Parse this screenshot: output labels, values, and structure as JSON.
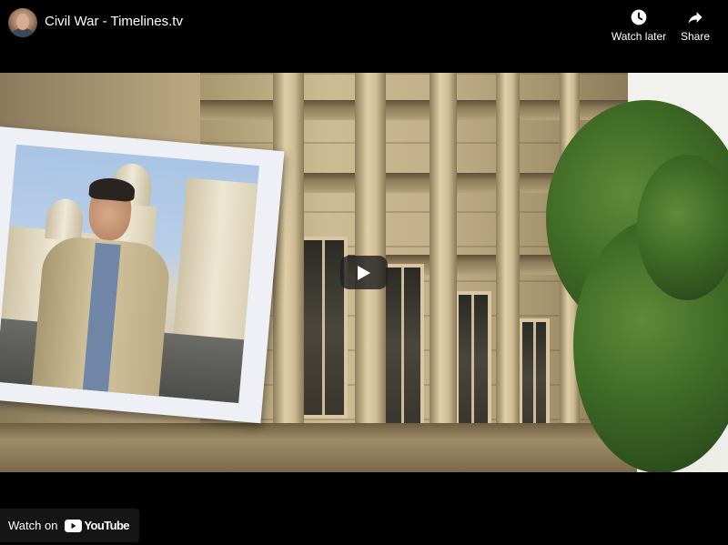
{
  "header": {
    "channel_avatar_icon": "channel-avatar",
    "title": "Civil War - Timelines.tv",
    "actions": [
      {
        "label": "Watch later",
        "icon": "clock-icon"
      },
      {
        "label": "Share",
        "icon": "share-arrow-icon"
      }
    ]
  },
  "player": {
    "play_icon": "play-icon",
    "play_button_color": "#212121"
  },
  "footer": {
    "watch_on_label": "Watch on",
    "platform_name": "YouTube",
    "brand_color": "#ff0000"
  }
}
